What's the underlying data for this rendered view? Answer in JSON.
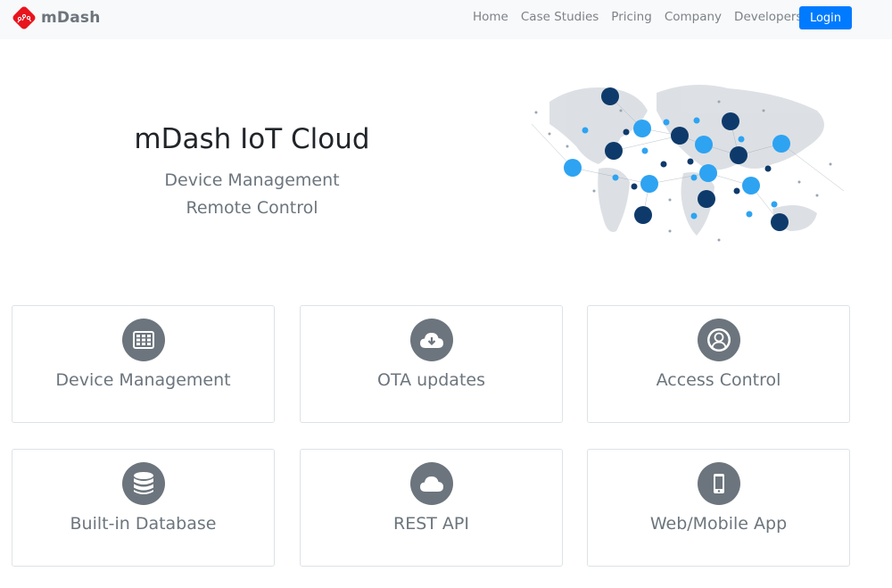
{
  "navbar": {
    "brand": "mDash",
    "links": [
      "Home",
      "Case Studies",
      "Pricing",
      "Company",
      "Developers"
    ],
    "login_label": "Login",
    "accent_color": "#007bff",
    "logo_color": "#e8141e"
  },
  "hero": {
    "title": "mDash IoT Cloud",
    "subtitle_line1": "Device Management",
    "subtitle_line2": "Remote Control",
    "illustration": "world-map-iot-network"
  },
  "features": [
    {
      "label": "Device Management",
      "icon": "table-icon"
    },
    {
      "label": "OTA updates",
      "icon": "cloud-download-icon"
    },
    {
      "label": "Access Control",
      "icon": "user-circle-icon"
    },
    {
      "label": "Built-in Database",
      "icon": "database-icon"
    },
    {
      "label": "REST API",
      "icon": "cloud-icon"
    },
    {
      "label": "Web/Mobile App",
      "icon": "mobile-icon"
    }
  ]
}
